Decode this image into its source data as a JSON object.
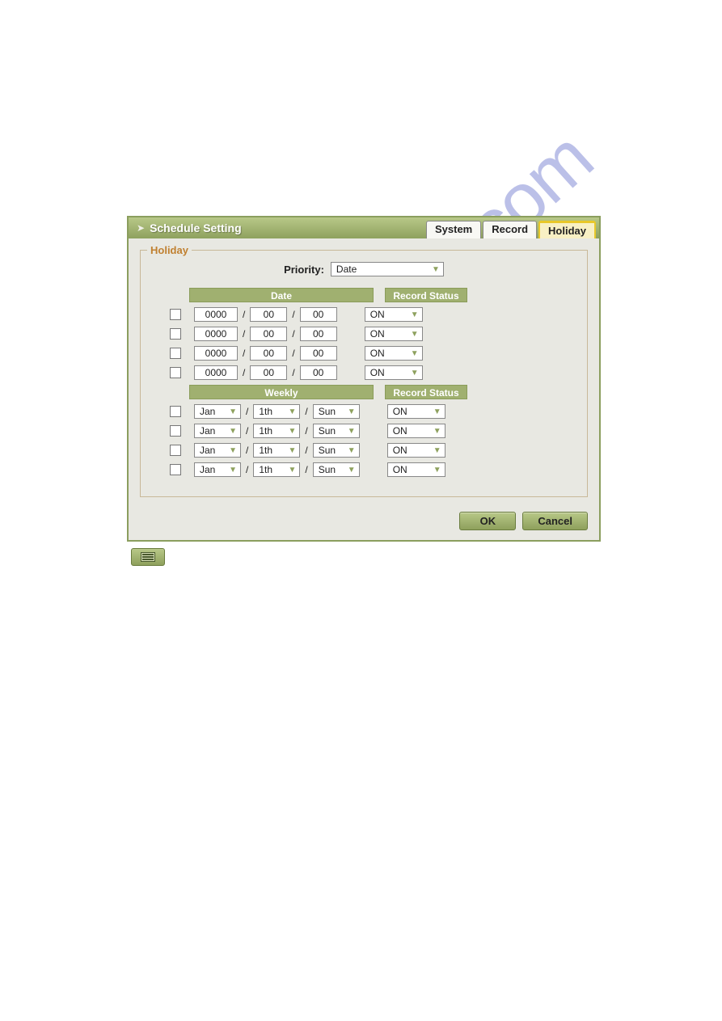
{
  "dialog": {
    "title": "Schedule Setting",
    "tabs": [
      "System",
      "Record",
      "Holiday"
    ],
    "active_tab": 2
  },
  "fieldset": {
    "legend": "Holiday",
    "priority_label": "Priority:",
    "priority_value": "Date"
  },
  "headers": {
    "date": "Date",
    "weekly": "Weekly",
    "record_status": "Record Status"
  },
  "date_rows": [
    {
      "checked": false,
      "year": "0000",
      "month": "00",
      "day": "00",
      "status": "ON"
    },
    {
      "checked": false,
      "year": "0000",
      "month": "00",
      "day": "00",
      "status": "ON"
    },
    {
      "checked": false,
      "year": "0000",
      "month": "00",
      "day": "00",
      "status": "ON"
    },
    {
      "checked": false,
      "year": "0000",
      "month": "00",
      "day": "00",
      "status": "ON"
    }
  ],
  "weekly_rows": [
    {
      "checked": false,
      "month": "Jan",
      "ord": "1th",
      "day": "Sun",
      "status": "ON"
    },
    {
      "checked": false,
      "month": "Jan",
      "ord": "1th",
      "day": "Sun",
      "status": "ON"
    },
    {
      "checked": false,
      "month": "Jan",
      "ord": "1th",
      "day": "Sun",
      "status": "ON"
    },
    {
      "checked": false,
      "month": "Jan",
      "ord": "1th",
      "day": "Sun",
      "status": "ON"
    }
  ],
  "separator": "/",
  "buttons": {
    "ok": "OK",
    "cancel": "Cancel"
  },
  "watermark": "manualshive.com"
}
